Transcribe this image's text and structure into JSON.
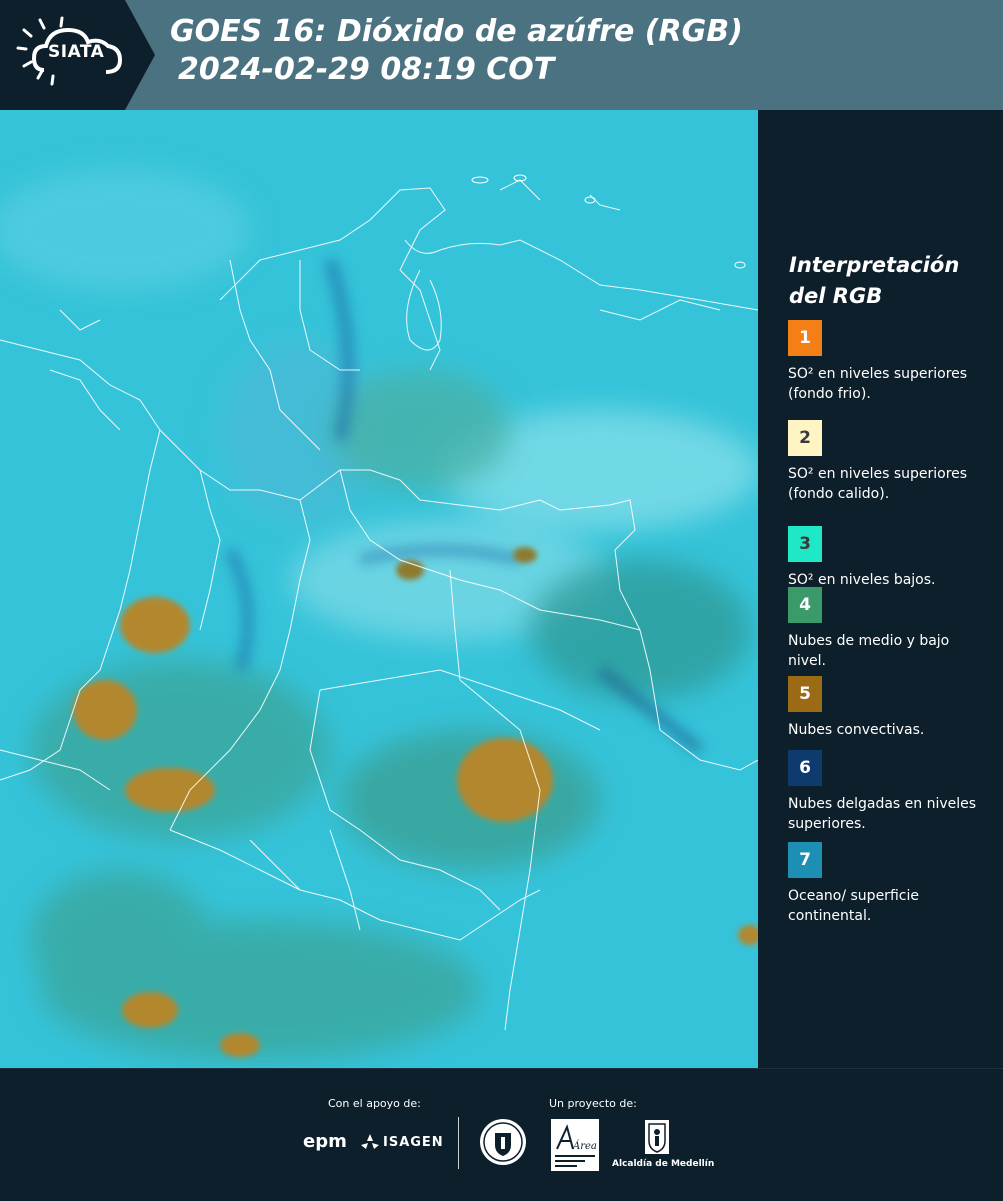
{
  "header": {
    "logo_text": "SIATA",
    "title": "GOES 16: Dióxido de azúfre (RGB)",
    "subtitle": " 2024-02-29 08:19 COT"
  },
  "map": {
    "icon": "satellite-map",
    "colors": {
      "background": "#33c2d8",
      "convective": "#b08a3a",
      "low_clouds": "#3b9a6a",
      "thin_high": "#2a5aa0"
    }
  },
  "legend": {
    "title": "Interpretación del RGB",
    "items": [
      {
        "number": "1",
        "color": "#f57f17",
        "text_color": "#ffffff",
        "label": "SO² en niveles superiores (fondo frio)."
      },
      {
        "number": "2",
        "color": "#fff5c4",
        "text_color": "#3a3a3a",
        "label": "SO² en niveles superiores (fondo calido)."
      },
      {
        "number": "3",
        "color": "#1fe8c6",
        "text_color": "#3a3a3a",
        "label": "SO² en niveles bajos."
      },
      {
        "number": "4",
        "color": "#3b9a6a",
        "text_color": "#ffffff",
        "label": "Nubes de medio y bajo nivel."
      },
      {
        "number": "5",
        "color": "#9a6a14",
        "text_color": "#ffffff",
        "label": "Nubes convectivas."
      },
      {
        "number": "6",
        "color": "#0e3a6e",
        "text_color": "#ffffff",
        "label": "Nubes delgadas en niveles superiores."
      },
      {
        "number": "7",
        "color": "#1e8fb4",
        "text_color": "#ffffff",
        "label": "Oceano/ superficie continental."
      }
    ]
  },
  "footer": {
    "support_label": "Con el apoyo de:",
    "project_label": "Un proyecto de:",
    "epm": "epm",
    "isagen": "ISAGEN",
    "area_metropolitana": "Área",
    "alcaldia": "Alcaldía de Medellín"
  }
}
